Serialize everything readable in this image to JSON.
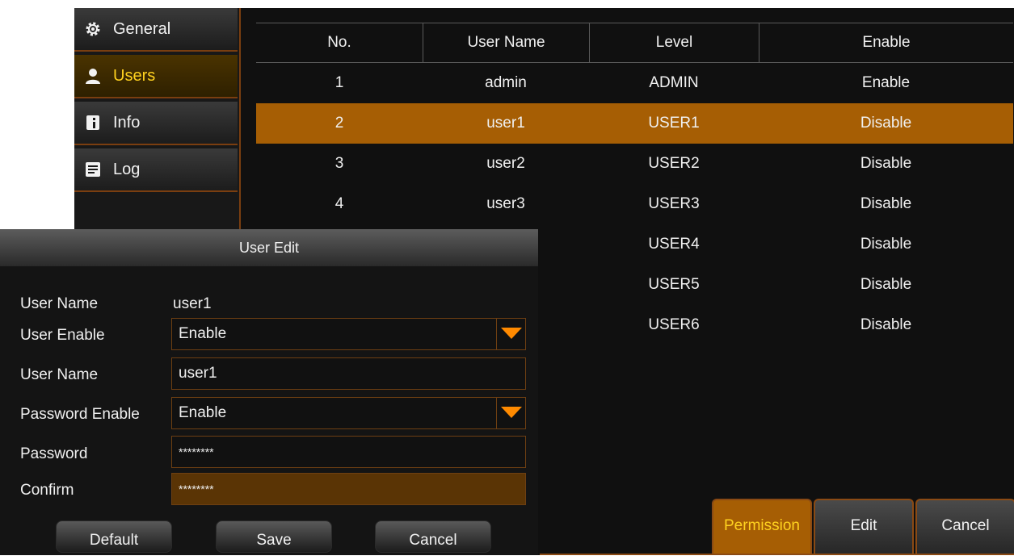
{
  "sidebar": {
    "items": [
      {
        "label": "General",
        "icon": "gear-icon"
      },
      {
        "label": "Users",
        "icon": "user-icon"
      },
      {
        "label": "Info",
        "icon": "info-icon"
      },
      {
        "label": "Log",
        "icon": "log-icon"
      }
    ],
    "active": "Users"
  },
  "table": {
    "headers": [
      "No.",
      "User Name",
      "Level",
      "Enable"
    ],
    "rows": [
      [
        "1",
        "admin",
        "ADMIN",
        "Enable"
      ],
      [
        "2",
        "user1",
        "USER1",
        "Disable"
      ],
      [
        "3",
        "user2",
        "USER2",
        "Disable"
      ],
      [
        "4",
        "user3",
        "USER3",
        "Disable"
      ],
      [
        "",
        "",
        "USER4",
        "Disable"
      ],
      [
        "",
        "",
        "USER5",
        "Disable"
      ],
      [
        "",
        "",
        "USER6",
        "Disable"
      ]
    ],
    "selected_row": 2
  },
  "bottom_buttons": {
    "permission": "Permission",
    "edit": "Edit",
    "cancel": "Cancel"
  },
  "dialog": {
    "title": "User Edit",
    "user_name_label": "User Name",
    "user_name_value": "user1",
    "user_enable_label": "User Enable",
    "user_enable_value": "Enable",
    "user_name_edit_label": "User Name",
    "user_name_edit_value": "user1",
    "password_enable_label": "Password Enable",
    "password_enable_value": "Enable",
    "password_label": "Password",
    "password_value": "********",
    "confirm_label": "Confirm",
    "confirm_value": "********",
    "default_button": "Default",
    "save_button": "Save",
    "cancel_button": "Cancel"
  },
  "colors": {
    "accent": "#a65e04",
    "active_text": "#ffd21f",
    "border": "#7a3e10",
    "dropdown_arrow": "#ff8a00"
  }
}
